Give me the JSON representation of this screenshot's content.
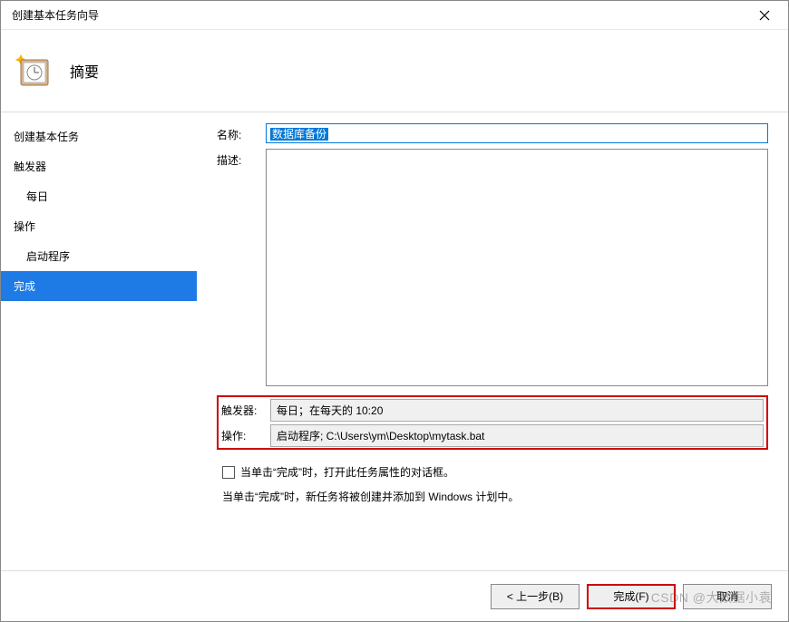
{
  "window": {
    "title": "创建基本任务向导"
  },
  "header": {
    "title": "摘要"
  },
  "sidebar": {
    "items": [
      {
        "label": "创建基本任务",
        "sub": false,
        "selected": false
      },
      {
        "label": "触发器",
        "sub": false,
        "selected": false
      },
      {
        "label": "每日",
        "sub": true,
        "selected": false
      },
      {
        "label": "操作",
        "sub": false,
        "selected": false
      },
      {
        "label": "启动程序",
        "sub": true,
        "selected": false
      },
      {
        "label": "完成",
        "sub": false,
        "selected": true
      }
    ]
  },
  "form": {
    "name_label": "名称:",
    "name_value": "数据库备份",
    "desc_label": "描述:",
    "desc_value": ""
  },
  "review": {
    "trigger_label": "触发器:",
    "trigger_value": "每日；在每天的 10:20",
    "action_label": "操作:",
    "action_value": "启动程序; C:\\Users\\ym\\Desktop\\mytask.bat"
  },
  "options": {
    "open_props_label": "当单击“完成”时，打开此任务属性的对话框。",
    "hint": "当单击“完成”时，新任务将被创建并添加到 Windows 计划中。"
  },
  "buttons": {
    "back": "< 上一步(B)",
    "finish": "完成(F)",
    "cancel": "取消"
  },
  "watermark": "CSDN @大数据小袁"
}
